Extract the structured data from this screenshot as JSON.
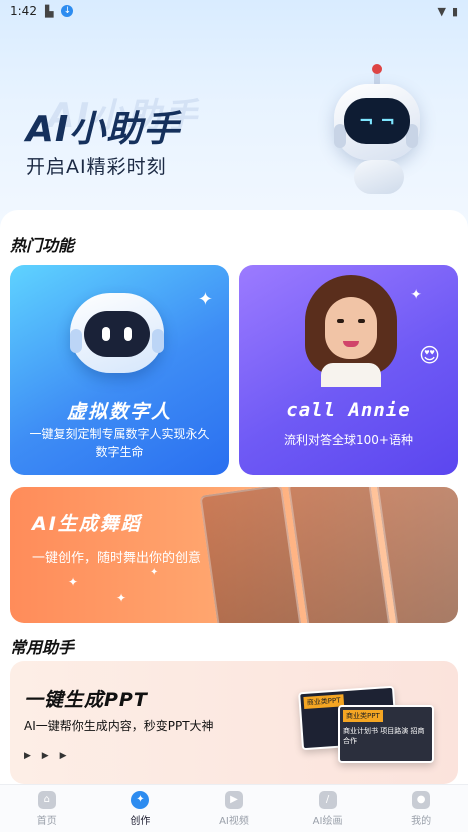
{
  "status_bar": {
    "time": "1:42",
    "icons": [
      "sd-card-icon",
      "download-icon",
      "wifi-icon",
      "battery-icon"
    ]
  },
  "hero": {
    "watermark": "AI小助手",
    "title": "AI小助手",
    "subtitle": "开启AI精彩时刻",
    "robot_eyes": "¬ ¬"
  },
  "hot_features": {
    "title": "热门功能",
    "cards": [
      {
        "title": "虚拟数字人",
        "desc": "一键复刻定制专属数字人实现永久数字生命",
        "sparkle": "✦"
      },
      {
        "title": "call  Annie",
        "desc": "流利对答全球100+语种",
        "sparkle": "✦",
        "emoji": "😍"
      }
    ]
  },
  "dance": {
    "title": "AI生成舞蹈",
    "subtitle": "一键创作，随时舞出你的创意"
  },
  "common": {
    "title": "常用助手",
    "ppt": {
      "title": "一键生成PPT",
      "subtitle": "AI一键帮你生成内容，秒变PPT大神",
      "arrows": "▶ ▶ ▶",
      "thumb_a": "商业类PPT",
      "thumb_b": "商业类PPT",
      "thumb_b_caption": "商业计划书 项目路演 招商合作"
    }
  },
  "bottom_nav": [
    {
      "label": "首页",
      "icon": "home-icon",
      "active": false
    },
    {
      "label": "创作",
      "icon": "lightbulb-icon",
      "active": true
    },
    {
      "label": "AI视频",
      "icon": "video-icon",
      "active": false
    },
    {
      "label": "AI绘画",
      "icon": "brush-icon",
      "active": false
    },
    {
      "label": "我的",
      "icon": "profile-icon",
      "active": false
    }
  ],
  "colors": {
    "accent": "#2d8cf0",
    "card_blue": "#3e8df5",
    "card_purple": "#6f5af5",
    "card_orange": "#ff8c5a"
  }
}
